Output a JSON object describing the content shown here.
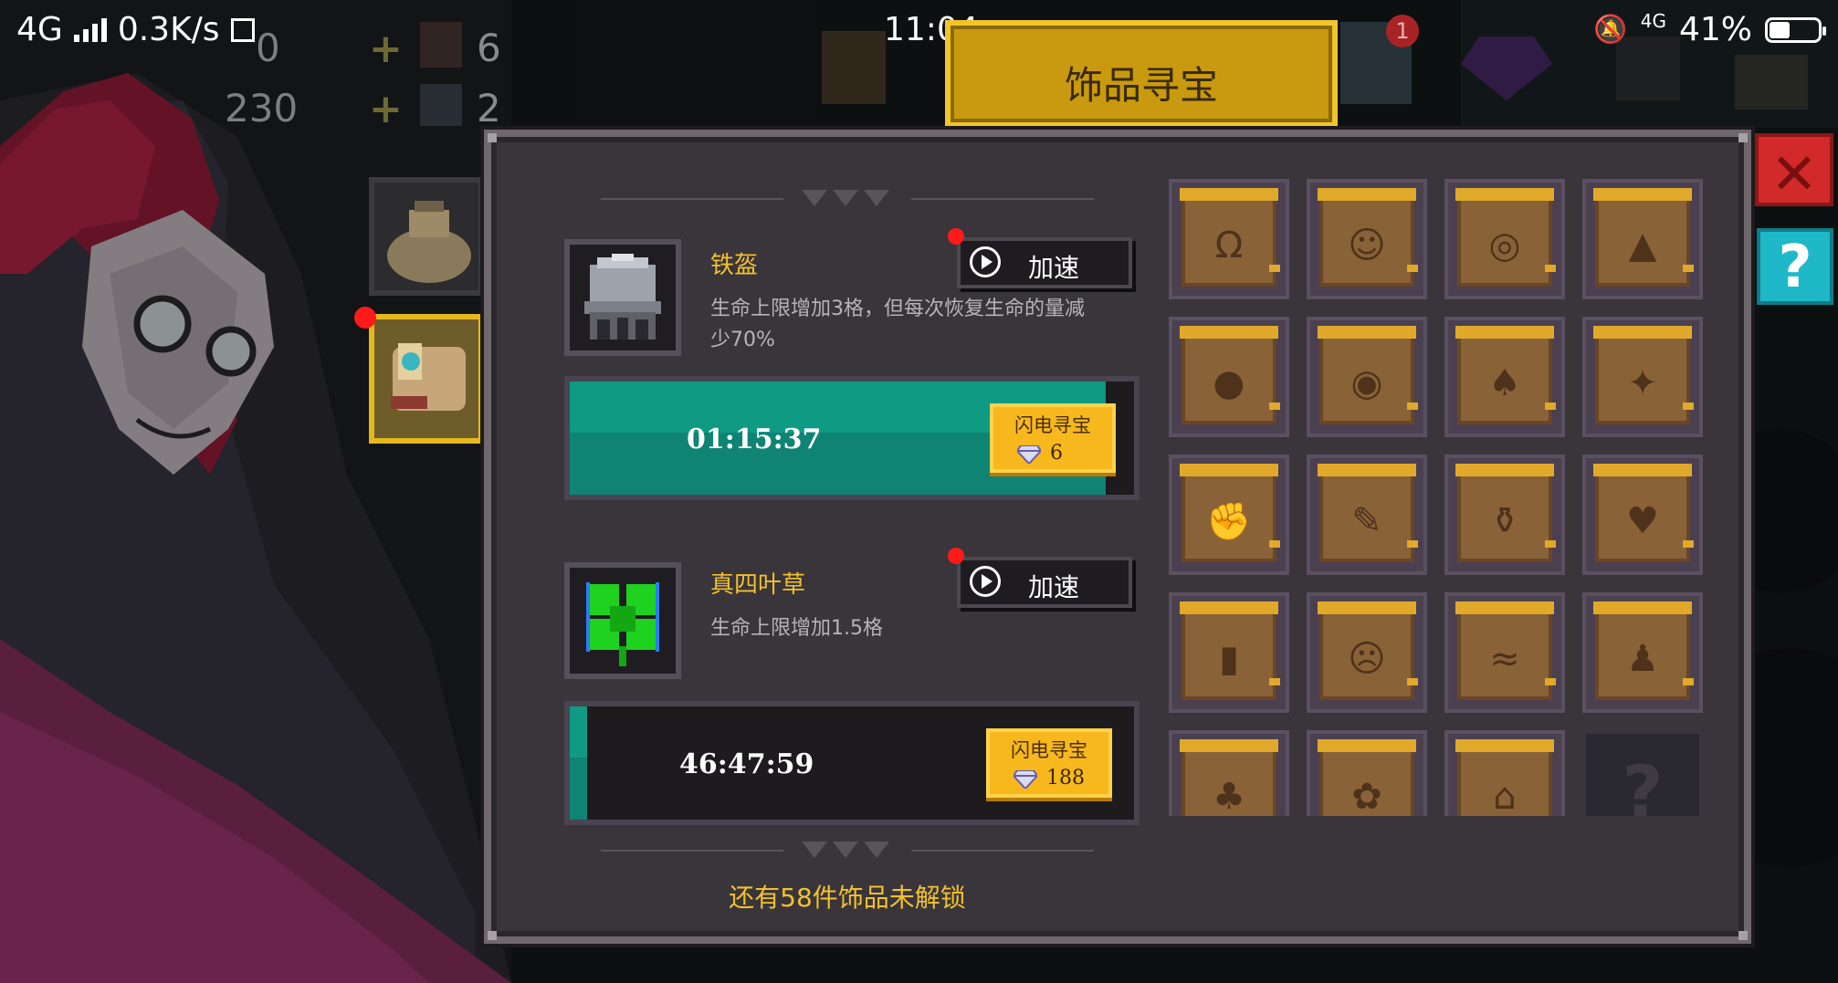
{
  "status_bar": {
    "network": "4G",
    "speed": "0.3K/s",
    "time": "11:04",
    "right_network": "4G",
    "battery": "41%",
    "battery_level_percent": 41
  },
  "hud": {
    "num_top": "0",
    "num_mid": "230",
    "count_a": "6",
    "count_b": "2",
    "badge_count": "1"
  },
  "title": "饰品寻宝",
  "quests": [
    {
      "icon": "iron-helmet-icon",
      "name": "铁盔",
      "desc_line1": "生命上限增加3格，但每次恢复生命的量减",
      "desc_line2": "少70%",
      "speed_label": "加速",
      "timer": "01:15:37",
      "progress_fraction": 0.95,
      "flash_label": "闪电寻宝",
      "gem_cost": "6"
    },
    {
      "icon": "four-leaf-clover-icon",
      "name": "真四叶草",
      "desc_line1": "生命上限增加1.5格",
      "desc_line2": "",
      "speed_label": "加速",
      "timer": "46:47:59",
      "progress_fraction": 0.03,
      "flash_label": "闪电寻宝",
      "gem_cost": "188"
    }
  ],
  "unlock_text": "还有58件饰品未解锁",
  "grid_slots": [
    {
      "icon": "necklace-scroll-icon",
      "glyph": "Ω"
    },
    {
      "icon": "smile-scroll-icon",
      "glyph": "☺"
    },
    {
      "icon": "ring-scroll-icon",
      "glyph": "◎"
    },
    {
      "icon": "triangle-scroll-icon",
      "glyph": "▲"
    },
    {
      "icon": "pouch-scroll-icon",
      "glyph": "●"
    },
    {
      "icon": "spiral-scroll-icon",
      "glyph": "◉"
    },
    {
      "icon": "bell-scroll-icon",
      "glyph": "♠"
    },
    {
      "icon": "star-scroll-icon",
      "glyph": "✦"
    },
    {
      "icon": "fist-scroll-icon",
      "glyph": "✊"
    },
    {
      "icon": "feather-scroll-icon",
      "glyph": "✎"
    },
    {
      "icon": "bottle-scroll-icon",
      "glyph": "⚱"
    },
    {
      "icon": "heart-scroll-icon",
      "glyph": "♥"
    },
    {
      "icon": "door-scroll-icon",
      "glyph": "▮"
    },
    {
      "icon": "face-scroll-icon",
      "glyph": "☹"
    },
    {
      "icon": "wave-scroll-icon",
      "glyph": "≈"
    },
    {
      "icon": "figure-scroll-icon",
      "glyph": "♟"
    },
    {
      "icon": "leaf-scroll-icon",
      "glyph": "♣"
    },
    {
      "icon": "gear-scroll-icon",
      "glyph": "✿"
    },
    {
      "icon": "house-scroll-icon",
      "glyph": "⌂"
    },
    {
      "icon": "locked-slot-icon",
      "glyph": "?",
      "locked": true
    }
  ],
  "buttons": {
    "close_icon": "close-icon",
    "help_icon": "help-icon",
    "help_glyph": "?"
  },
  "colors": {
    "accent_gold": "#f2c12e",
    "progress_teal": "#0f8474",
    "close_red": "#d22a2a",
    "help_cyan": "#1fb8c9"
  }
}
